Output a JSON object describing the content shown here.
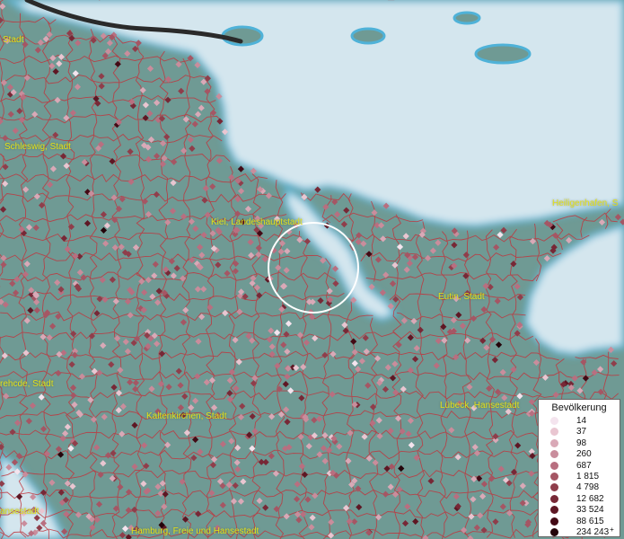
{
  "map": {
    "colors": {
      "land": "#6f9a94",
      "water": "#d4e6ee",
      "water_edge": "#4fb2d8",
      "boundary": "#c0353d",
      "road": "#2a2a2a",
      "label": "#e3e01a",
      "highlight_ring": "#ffffff"
    },
    "places": {
      "stadt_nw": "Stadt",
      "schleswig": "Schleswig, Stadt",
      "kiel": "Kiel, Landeshauptstadt",
      "heiligenhafen": "Heiligenhafen, S",
      "eutin": "Eutin, Stadt",
      "rendsburg_fragment": "rehcde, Stadt",
      "kaltenkirchen": "Kaltenkirchen, Stadt",
      "luebeck": "Lübeck, Hansestadt",
      "hansestadt_sw": "ansestadt",
      "hamburg": "Hamburg, Freie und Hansestadt"
    }
  },
  "legend": {
    "title": "Bevölkerung",
    "classes": [
      {
        "label": "14",
        "color": "#f4e4ee"
      },
      {
        "label": "37",
        "color": "#e9c6d1"
      },
      {
        "label": "98",
        "color": "#d9a9b7"
      },
      {
        "label": "260",
        "color": "#c98d9c"
      },
      {
        "label": "687",
        "color": "#b86f80"
      },
      {
        "label": "1 815",
        "color": "#a55664"
      },
      {
        "label": "4 798",
        "color": "#8f3e4b"
      },
      {
        "label": "12 682",
        "color": "#772836"
      },
      {
        "label": "33 524",
        "color": "#5e1724"
      },
      {
        "label": "88 615",
        "color": "#430a15"
      },
      {
        "label": "234 243",
        "color": "#24040a",
        "plus": "+"
      }
    ]
  }
}
